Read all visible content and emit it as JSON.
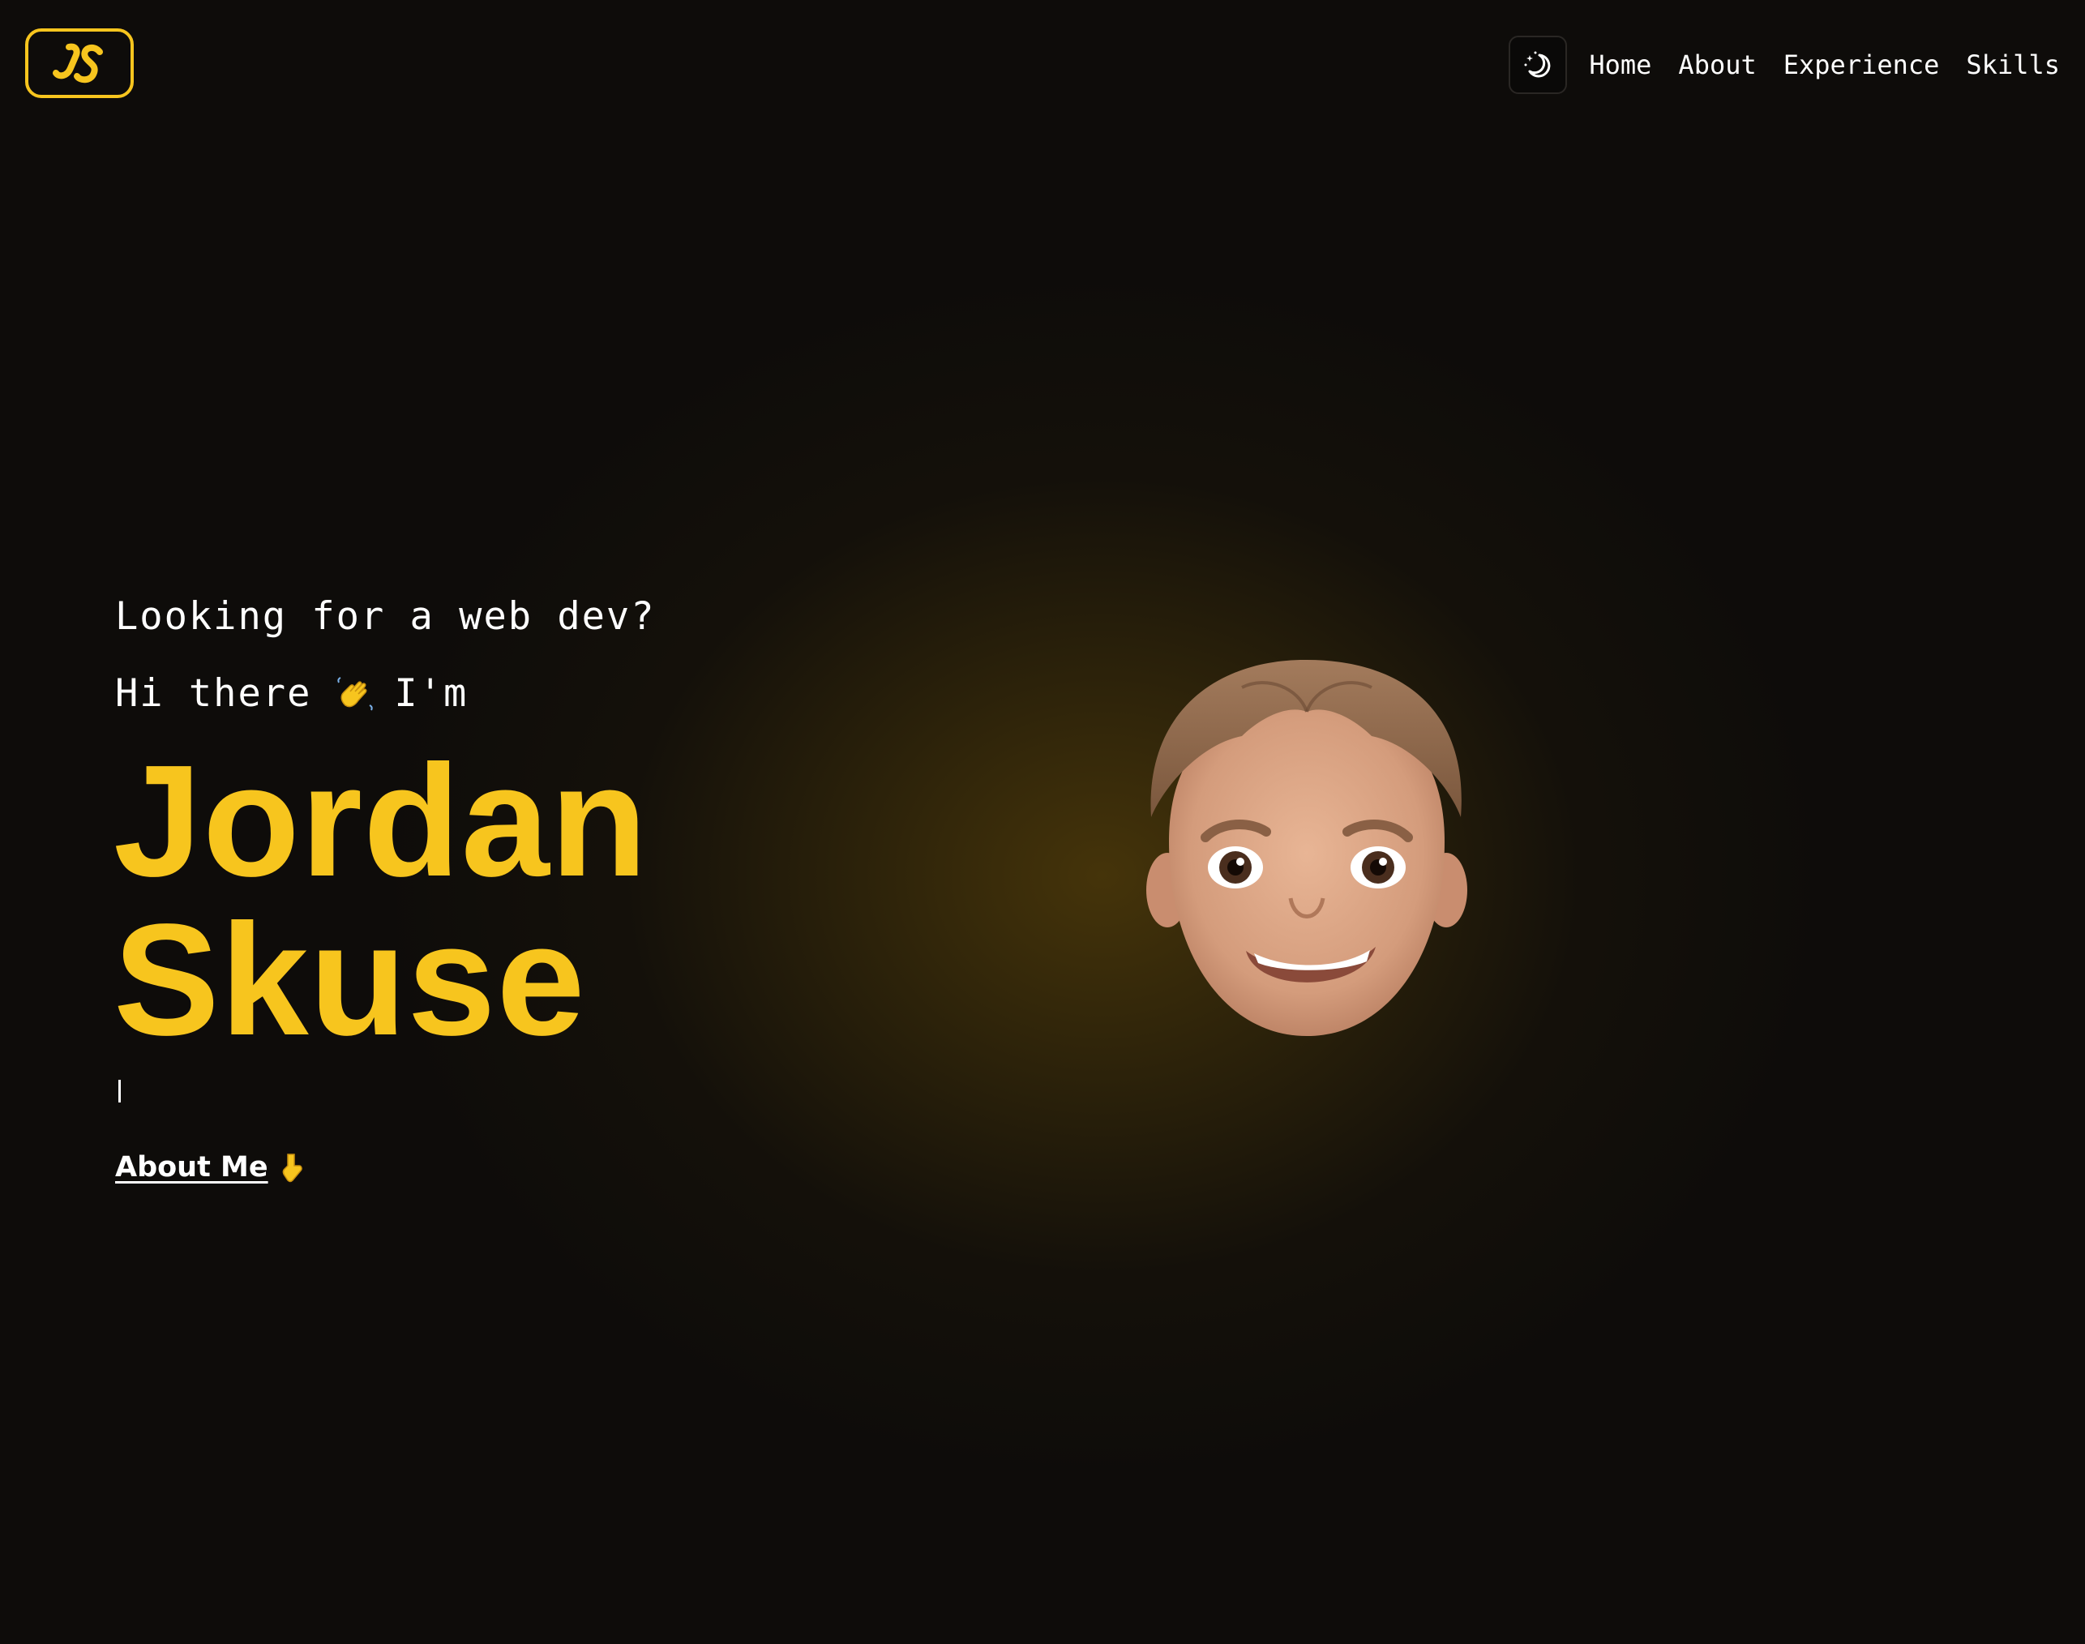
{
  "header": {
    "logo_icon": "js-monogram-logo",
    "theme_toggle_icon": "moon-stars-icon",
    "nav": [
      {
        "label": "Home"
      },
      {
        "label": "About"
      },
      {
        "label": "Experience"
      },
      {
        "label": "Skills"
      }
    ]
  },
  "hero": {
    "tagline": "Looking for a web dev?",
    "greeting_prefix": "Hi there",
    "greeting_icon": "waving-hand-icon",
    "greeting_suffix": "I'm",
    "name_first": "Jordan",
    "name_last": "Skuse",
    "typing_cursor": "|",
    "about_link_label": "About Me",
    "about_link_icon": "pointing-down-icon",
    "avatar": "memoji-avatar"
  },
  "colors": {
    "accent": "#f7c51e",
    "background": "#0e0c0a",
    "text": "#ffffff"
  }
}
